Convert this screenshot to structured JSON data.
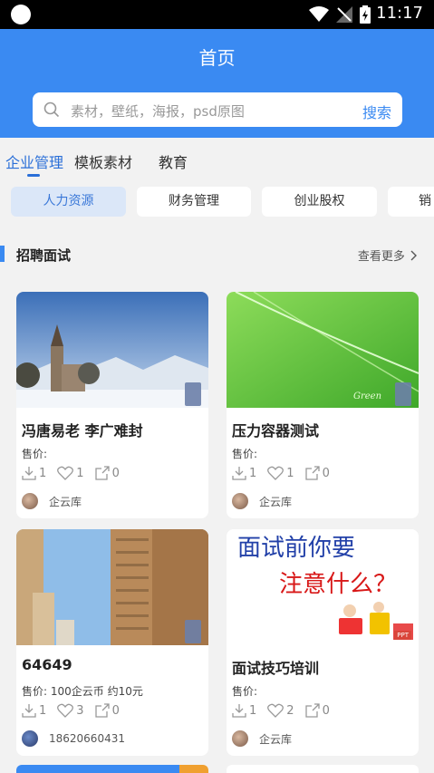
{
  "status_bar": {
    "time": "11:17"
  },
  "header": {
    "title": "首页"
  },
  "search": {
    "placeholder": "素材，壁纸，海报，psd原图",
    "button": "搜索"
  },
  "tabs": [
    {
      "label": "企业管理",
      "active": true
    },
    {
      "label": "模板素材",
      "active": false
    },
    {
      "label": "教育",
      "active": false
    }
  ],
  "chips": [
    {
      "label": "人力资源",
      "active": true
    },
    {
      "label": "财务管理",
      "active": false
    },
    {
      "label": "创业股权",
      "active": false
    },
    {
      "label": "销",
      "active": false
    }
  ],
  "section": {
    "title": "招聘面试",
    "more": "查看更多"
  },
  "cards": [
    {
      "title": "冯唐易老 李广难封",
      "price": "售价:",
      "downloads": "1",
      "likes": "1",
      "shares": "0",
      "author": "企云库",
      "image": "castle-winter-landscape"
    },
    {
      "title": "压力容器测试",
      "price": "售价:",
      "downloads": "1",
      "likes": "1",
      "shares": "0",
      "author": "企云库",
      "image": "green-abstract-wave"
    },
    {
      "title": "64649",
      "price": "售价:   100企云币 约10元",
      "downloads": "1",
      "likes": "3",
      "shares": "0",
      "author": "18620660431",
      "image": "city-buildings"
    },
    {
      "title": "面试技巧培训",
      "price": "售价:",
      "downloads": "1",
      "likes": "2",
      "shares": "0",
      "author": "企云库",
      "image": "interview-text-cover",
      "cover_line1": "面试前你要",
      "cover_line2": "注意什么？",
      "cover_badge": "PPT"
    }
  ],
  "colors": {
    "primary": "#3a8af2",
    "accent_text": "#2a6fd8",
    "chip_active_bg": "#dbe7f8"
  }
}
